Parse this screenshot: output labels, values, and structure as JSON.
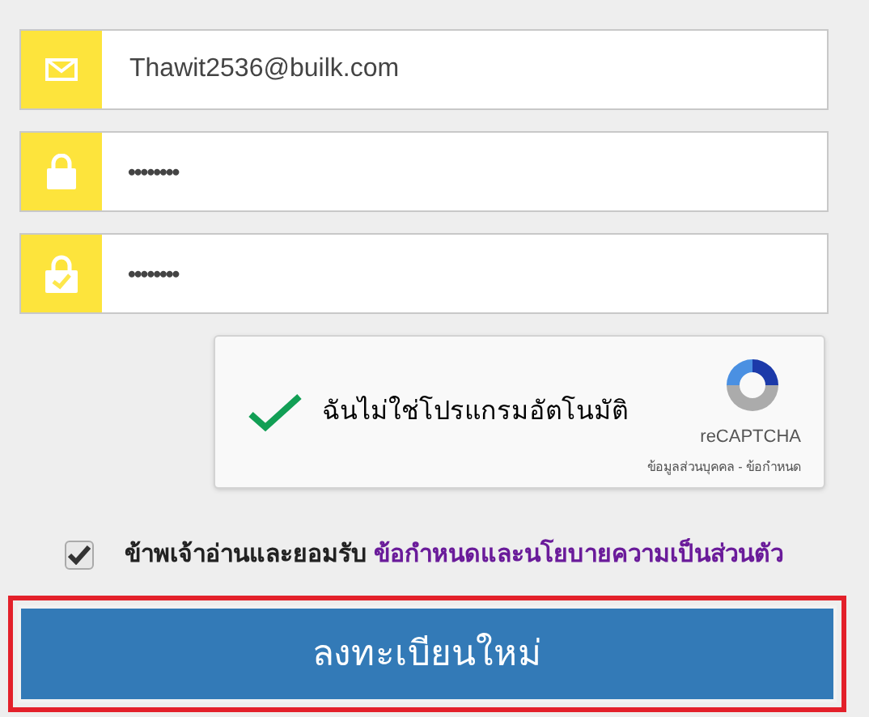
{
  "fields": [
    {
      "kind": "email",
      "value": "Thawit2536@builk.com"
    },
    {
      "kind": "password",
      "value": "••••••••"
    },
    {
      "kind": "confirm_password",
      "value": "••••••••"
    }
  ],
  "captcha": {
    "checked": true,
    "label": "ฉันไม่ใช่โปรแกรมอัตโนมัติ",
    "brand": "reCAPTCHA",
    "links": "ข้อมูลส่วนบุคคล - ข้อกำหนด"
  },
  "agreement": {
    "checked": true,
    "text": "ข้าพเจ้าอ่านและยอมรับ",
    "link": "ข้อกำหนดและนโยบายความเป็นส่วนตัว"
  },
  "submit": {
    "label": "ลงทะเบียนใหม่",
    "highlighted": true
  }
}
